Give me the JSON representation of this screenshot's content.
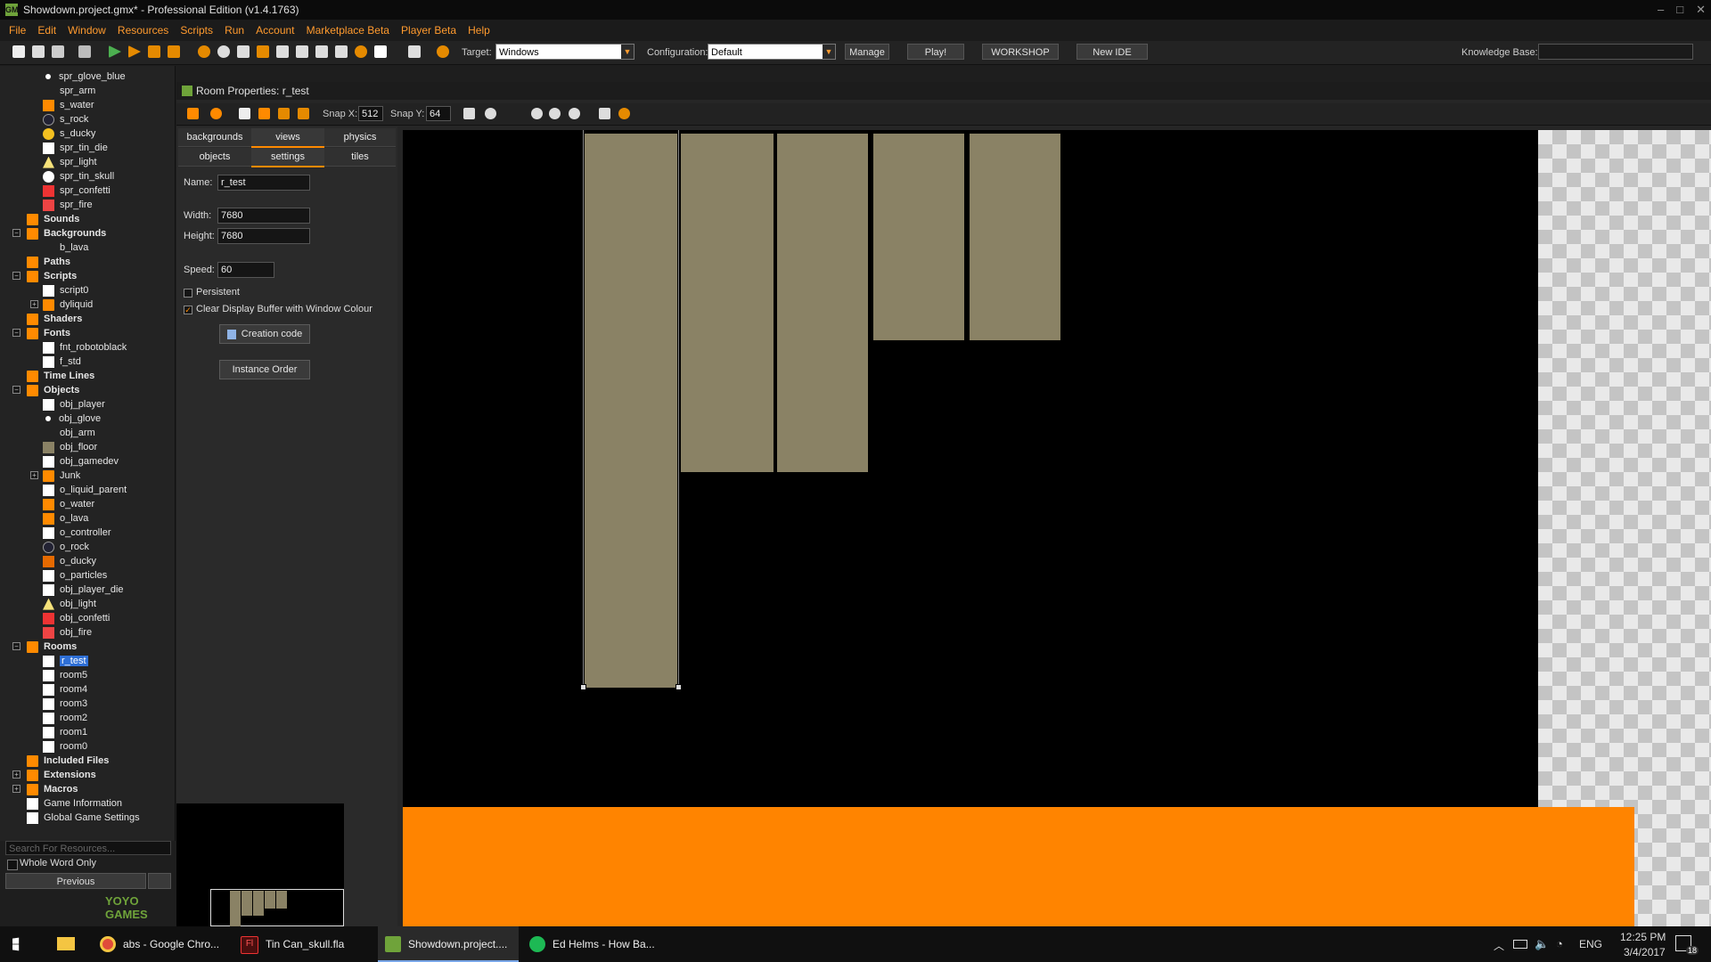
{
  "window": {
    "title": "Showdown.project.gmx* - Professional Edition (v1.4.1763)",
    "app_icon": "gamemaker-logo-icon",
    "controls": [
      "minimize",
      "maximize",
      "close"
    ]
  },
  "menu": [
    "File",
    "Edit",
    "Window",
    "Resources",
    "Scripts",
    "Run",
    "Account",
    "Marketplace Beta",
    "Player Beta",
    "Help"
  ],
  "toolbar": {
    "target_label": "Target:",
    "target_value": "Windows",
    "config_label": "Configuration:",
    "config_value": "Default",
    "manage": "Manage",
    "play": "Play!",
    "workshop": "WORKSHOP",
    "new_ide": "New IDE",
    "kb_label": "Knowledge Base:"
  },
  "tree": {
    "items": [
      "spr_glove_blue",
      "spr_arm",
      "s_water",
      "s_rock",
      "s_ducky",
      "spr_tin_die",
      "spr_light",
      "spr_tin_skull",
      "spr_confetti",
      "spr_fire",
      "Sounds",
      "Backgrounds",
      "b_lava",
      "Paths",
      "Scripts",
      "script0",
      "dyliquid",
      "Shaders",
      "Fonts",
      "fnt_robotoblack",
      "f_std",
      "Time Lines",
      "Objects",
      "obj_player",
      "obj_glove",
      "obj_arm",
      "obj_floor",
      "obj_gamedev",
      "Junk",
      "o_liquid_parent",
      "o_water",
      "o_lava",
      "o_controller",
      "o_rock",
      "o_ducky",
      "o_particles",
      "obj_player_die",
      "obj_light",
      "obj_confetti",
      "obj_fire",
      "Rooms",
      "r_test",
      "room5",
      "room4",
      "room3",
      "room2",
      "room1",
      "room0",
      "Included Files",
      "Extensions",
      "Macros",
      "Game Information",
      "Global Game Settings"
    ],
    "search_placeholder": "Search For Resources...",
    "whole_word": "Whole Word Only",
    "previous": "Previous"
  },
  "logo_text": "YOYO GAMES",
  "room": {
    "title": "Room Properties: r_test",
    "snap_x_label": "Snap X:",
    "snap_x": "512",
    "snap_y_label": "Snap Y:",
    "snap_y": "64",
    "tabs_row1": [
      "backgrounds",
      "views",
      "physics"
    ],
    "tabs_row2": [
      "objects",
      "settings",
      "tiles"
    ],
    "name_label": "Name:",
    "name": "r_test",
    "width_label": "Width:",
    "width": "7680",
    "height_label": "Height:",
    "height": "7680",
    "speed_label": "Speed:",
    "speed": "60",
    "persistent": "Persistent",
    "clear_buffer": "Clear Display Buffer with Window Colour",
    "creation_code": "Creation code",
    "instance_order": "Instance Order"
  },
  "taskbar": {
    "items": [
      "abs - Google Chro...",
      "Tin Can_skull.fla",
      "Showdown.project....",
      "Ed Helms - How Ba..."
    ],
    "lang": "ENG",
    "time": "12:25 PM",
    "date": "3/4/2017",
    "notifications": "18"
  },
  "colors": {
    "accent": "#ff8a00",
    "menu_text": "#ff9a2e",
    "tile": "#8a8265",
    "lava": "#ff8400"
  }
}
